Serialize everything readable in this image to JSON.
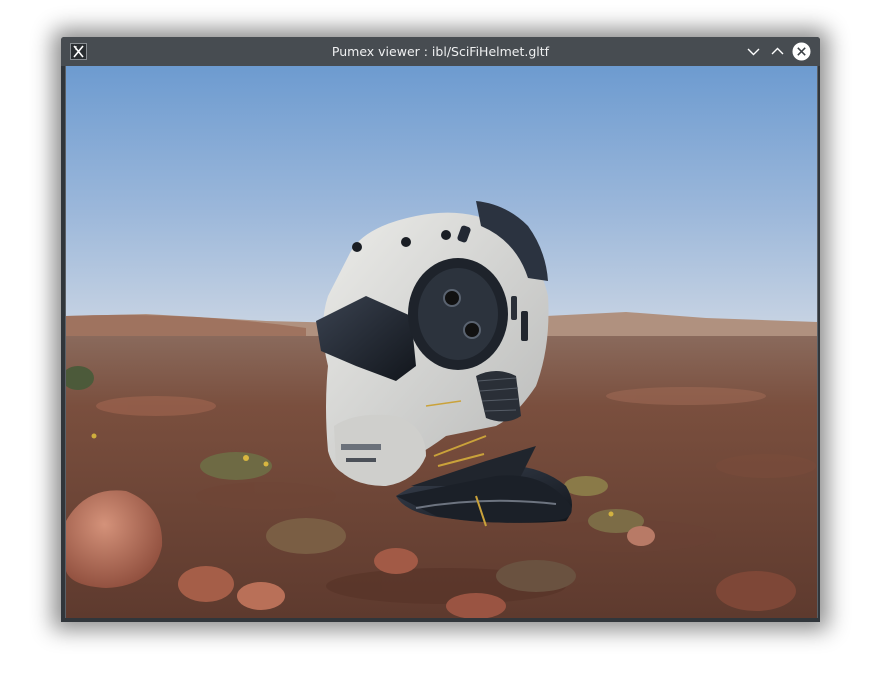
{
  "window": {
    "title": "Pumex viewer : ibl/SciFiHelmet.gltf",
    "app_icon": "x-window-icon",
    "buttons": {
      "minimize_icon": "chevron-down-icon",
      "maximize_icon": "chevron-up-icon",
      "close_icon": "close-icon"
    }
  },
  "viewport": {
    "content": "sci-fi-helmet-model-over-desert-environment",
    "colors": {
      "sky_top": "#6d9bd0",
      "sky_horizon": "#c7d3e3",
      "ground": "#7a4f3e",
      "helmet_white": "#d9d9d6",
      "helmet_dark": "#1d222a"
    }
  }
}
